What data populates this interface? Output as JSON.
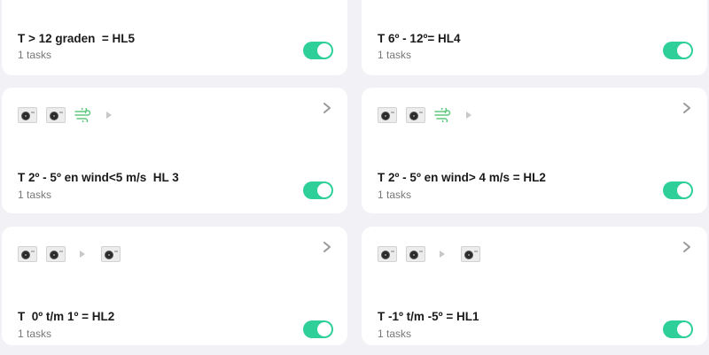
{
  "accent_color": "#2fcf9a",
  "rows": [
    {
      "title": "T > 12 graden  = HL5",
      "subtitle": "1 tasks",
      "enabled": true,
      "icons": []
    },
    {
      "title": "T 6º - 12º= HL4",
      "subtitle": "1 tasks",
      "enabled": true,
      "icons": []
    },
    {
      "title": "T 2º - 5º en wind<5 m/s  HL 3",
      "subtitle": "1 tasks",
      "enabled": true,
      "icons": [
        "heat-pump-icon",
        "heat-pump-icon",
        "wind-icon",
        "arrow-right-icon"
      ]
    },
    {
      "title": "T 2º - 5º en wind> 4 m/s = HL2",
      "subtitle": "1 tasks",
      "enabled": true,
      "icons": [
        "heat-pump-icon",
        "heat-pump-icon",
        "wind-icon",
        "arrow-right-icon"
      ]
    },
    {
      "title": "T  0º t/m 1º = HL2",
      "subtitle": "1 tasks",
      "enabled": true,
      "icons": [
        "heat-pump-icon",
        "heat-pump-icon",
        "arrow-right-icon",
        "heat-pump-icon"
      ]
    },
    {
      "title": "T -1º t/m -5º = HL1",
      "subtitle": "1 tasks",
      "enabled": true,
      "icons": [
        "heat-pump-icon",
        "heat-pump-icon",
        "arrow-right-icon",
        "heat-pump-icon"
      ]
    }
  ]
}
